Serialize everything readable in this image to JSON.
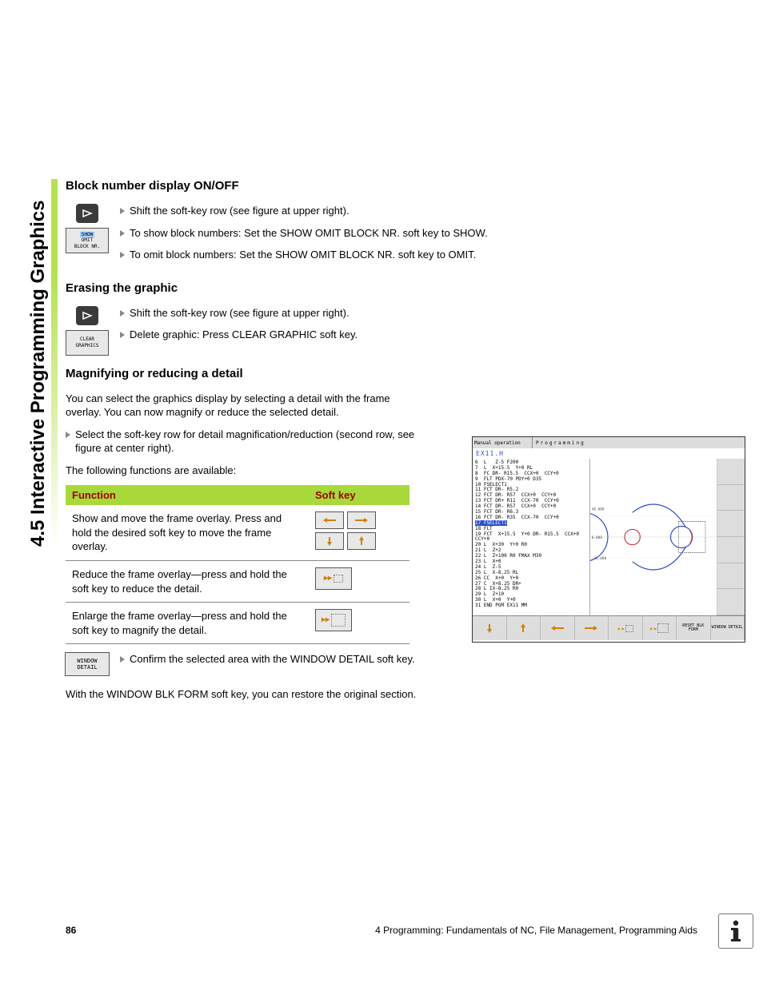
{
  "side_tab": "4.5 Interactive Programming Graphics",
  "sec1": {
    "heading": "Block number display ON/OFF",
    "softkey_lines": [
      "SHOW",
      "OMIT",
      "BLOCK NR."
    ],
    "b1": "Shift the soft-key row (see figure at upper right).",
    "b2": "To show block numbers: Set the SHOW OMIT BLOCK NR. soft key to SHOW.",
    "b3": "To omit block numbers: Set the SHOW OMIT BLOCK NR. soft key to OMIT."
  },
  "sec2": {
    "heading": "Erasing the graphic",
    "softkey_lines": [
      "CLEAR",
      "GRAPHICS"
    ],
    "b1": "Shift the soft-key row (see figure at upper right).",
    "b2": "Delete graphic: Press CLEAR GRAPHIC soft key."
  },
  "sec3": {
    "heading": "Magnifying or reducing a detail",
    "p1": "You can select the graphics display by selecting a detail with the frame overlay. You can now magnify or reduce the selected detail.",
    "p2_prefix": "Select the soft-key row for detail magnification/reduction (second row, see figure at center right).",
    "p3": "The following functions are available:",
    "table": {
      "h1": "Function",
      "h2": "Soft key",
      "r1": "Show and move the frame overlay. Press and hold the desired soft key to move the frame overlay.",
      "r2": "Reduce the frame overlay—press and hold the soft key to reduce the detail.",
      "r3": "Enlarge the frame overlay—press and hold the soft key to magnify the detail."
    },
    "wd_softkey": [
      "WINDOW",
      "DETAIL"
    ],
    "confirm": "Confirm the selected area with the WINDOW DETAIL soft key.",
    "p4": "With the WINDOW BLK FORM soft key, you can restore the original section."
  },
  "screenshot": {
    "mode_left": "Manual operation",
    "mode_right": "Programming",
    "prog_name": "EX11.H",
    "code": "6  L   Z-5 F200\n7  L  X+15.5  Y+0 RL\n8  FC DR- R15.5  CCX+0  CCY+0\n9  FLT PDX-70 PDY+0 D35\n10 FSELECT1\n11 FCT DR- R5.2\n12 FCT DR- R57  CCX+0  CCY+0\n13 FCT DR+ R11  CCX-70  CCY+0\n14 FCT DR- R57  CCX+0  CCY+0\n15 FCT DR- R6.3\n16 FCT DR- R35  CCX-70  CCY+0",
    "code_hl": "17 FSELECT1",
    "code2": "18 FLT\n19 FCT  X+15.5  Y+0 DR- R15.5  CCX+0\nCCY+0\n20 L  X+30  Y+0 R0\n21 L  Z+2\n22 L  Z+100 R0 FMAX M30\n23 L  X+0\n24 L  Z-5\n25 L  X-8.25 RL\n26 CC  X+0  Y+0\n27 C  X+8.25 DR+\n28 L IX-8.25 R0\n29 L  Z+10\n30 L  X+0  Y+0\n31 END PGM EX11 MM",
    "bottom_labels": [
      "",
      "",
      "",
      "",
      "",
      "",
      "RESET BLK FORM",
      "WINDOW DETAIL"
    ]
  },
  "footer": {
    "page": "86",
    "chapter": "4 Programming: Fundamentals of NC, File Management, Programming Aids"
  },
  "chart_data": {
    "type": "line",
    "title": "",
    "xlabel": "",
    "ylabel": "",
    "series": [
      {
        "name": "toolpath",
        "note": "closed profile consisting of two lobes joined by tangential arcs; right lobe ~R15.5 centered (0,0), left lobe ~R35/R11 centered (-70,0), outer arcs R57"
      }
    ],
    "xlim": [
      -120,
      40
    ],
    "ylim": [
      -60,
      60
    ],
    "y_ticks": [
      -30,
      0,
      30,
      40
    ],
    "x_ticks": [
      -120,
      -30,
      40
    ],
    "annotations": [
      "detail frame overlay shown near right lobe"
    ]
  }
}
